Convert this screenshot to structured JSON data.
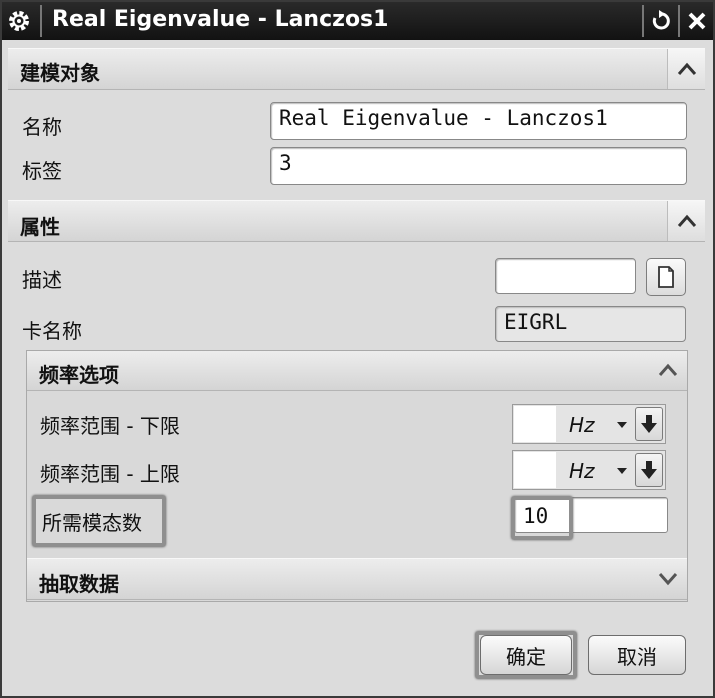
{
  "window": {
    "title": "Real Eigenvalue - Lanczos1"
  },
  "modeling_object": {
    "header": "建模对象",
    "name_label": "名称",
    "name_value": "Real Eigenvalue - Lanczos1",
    "tag_label": "标签",
    "tag_value": "3"
  },
  "properties": {
    "header": "属性",
    "description_label": "描述",
    "description_value": "",
    "card_name_label": "卡名称",
    "card_name_value": "EIGRL"
  },
  "frequency_options": {
    "header": "频率选项",
    "lower_label": "频率范围 - 下限",
    "lower_value": "",
    "lower_unit": "Hz",
    "upper_label": "频率范围 - 上限",
    "upper_value": "",
    "upper_unit": "Hz",
    "modes_label": "所需模态数",
    "modes_value": "10"
  },
  "extract_data": {
    "header": "抽取数据"
  },
  "buttons": {
    "ok": "确定",
    "cancel": "取消"
  }
}
